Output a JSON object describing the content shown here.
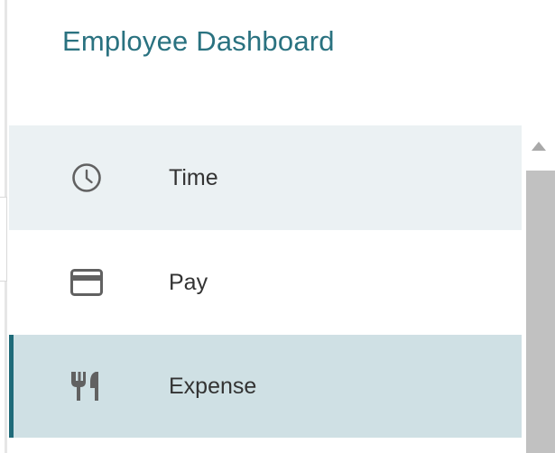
{
  "header": {
    "title": "Employee Dashboard"
  },
  "menu": {
    "items": [
      {
        "label": "Time",
        "icon": "clock-icon",
        "state": "hovered"
      },
      {
        "label": "Pay",
        "icon": "credit-card-icon",
        "state": "default"
      },
      {
        "label": "Expense",
        "icon": "fork-knife-icon",
        "state": "selected"
      }
    ]
  },
  "colors": {
    "title": "#2a7280",
    "accent": "#1f6b79",
    "hover_bg": "#ebf1f3",
    "selected_bg": "#cfe0e4",
    "icon": "#616161",
    "text": "#333333"
  }
}
